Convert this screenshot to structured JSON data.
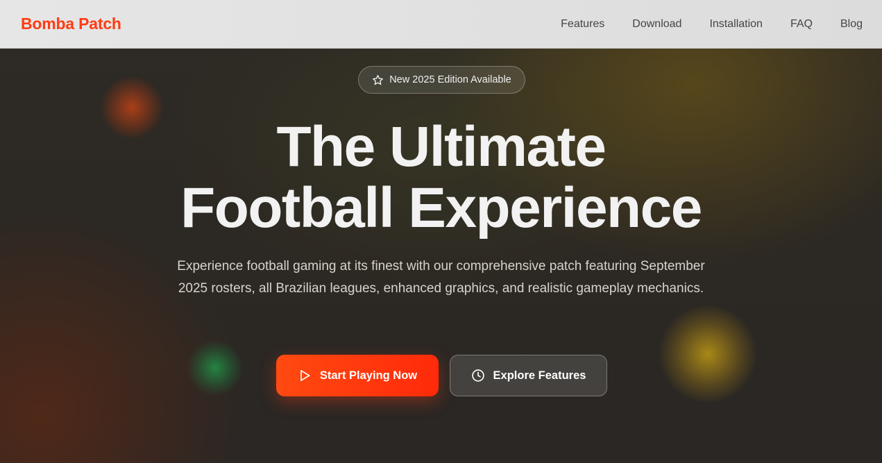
{
  "brand": {
    "name": "Bomba Patch",
    "color": "#ff3c14"
  },
  "nav": {
    "items": [
      {
        "label": "Features"
      },
      {
        "label": "Download"
      },
      {
        "label": "Installation"
      },
      {
        "label": "FAQ"
      },
      {
        "label": "Blog"
      }
    ]
  },
  "hero": {
    "badge": {
      "icon": "star-icon",
      "label": "New 2025 Edition Available"
    },
    "title_line1": "The Ultimate",
    "title_line2": "Football Experience",
    "subtitle": "Experience football gaming at its finest with our comprehensive patch featuring September 2025 rosters, all Brazilian leagues, enhanced graphics, and realistic gameplay mechanics.",
    "primary_button": {
      "icon": "play-icon",
      "label": "Start Playing Now",
      "color": "#ff3c14"
    },
    "secondary_button": {
      "icon": "clock-icon",
      "label": "Explore Features"
    }
  }
}
